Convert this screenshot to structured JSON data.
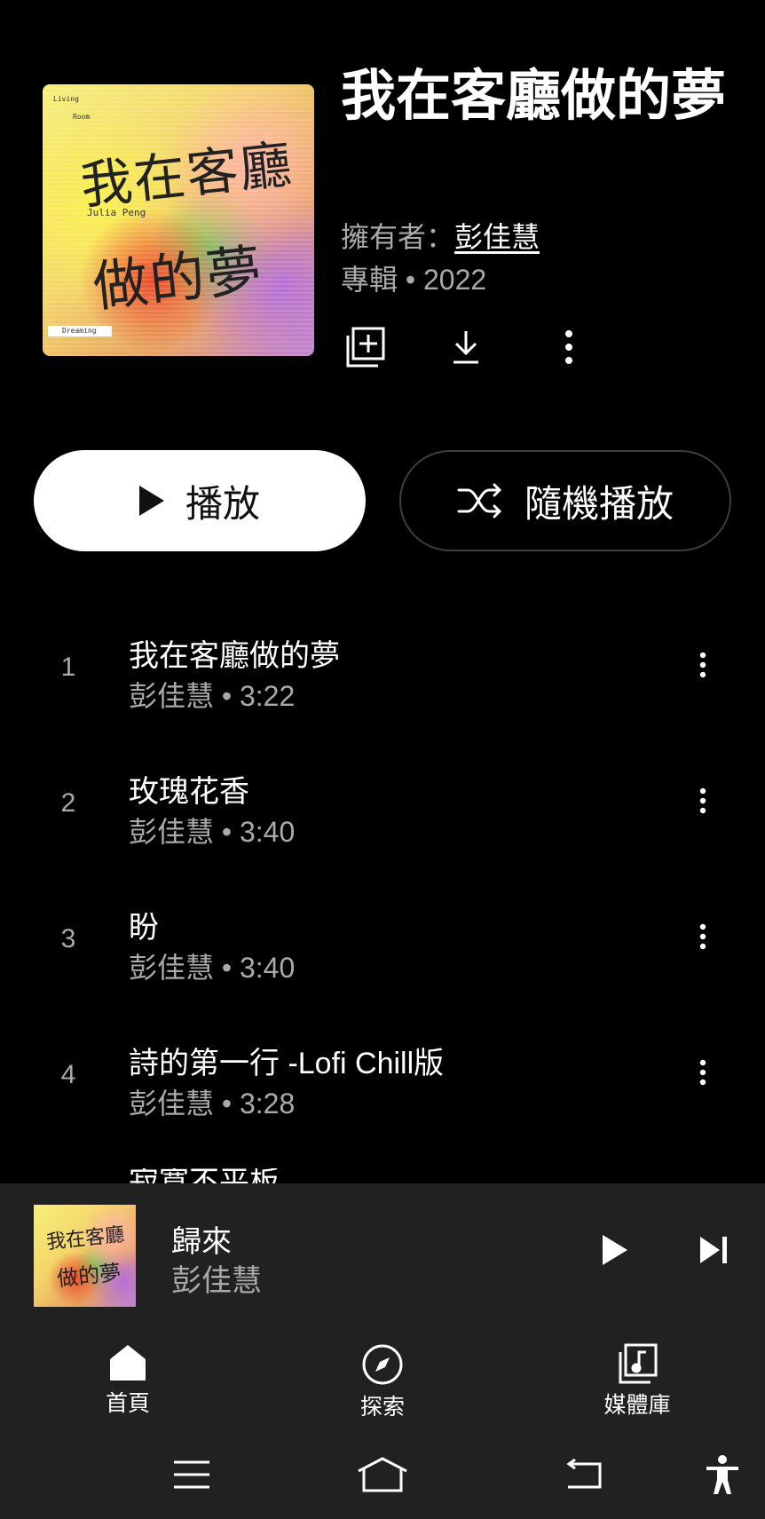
{
  "album": {
    "title": "我在客廳做的夢",
    "owner_label": "擁有者：",
    "owner_name": "彭佳慧",
    "meta": "專輯 • 2022",
    "cover_text": {
      "top_left_1": "Living",
      "top_left_2": "Room",
      "bottom_left": "Dreaming",
      "artist_en": "Julia Peng",
      "line1": "我在客廳",
      "line2": "做的夢"
    }
  },
  "header_actions": {
    "save_icon": "add-to-library-icon",
    "download_icon": "download-icon",
    "more_icon": "more-vert-icon"
  },
  "buttons": {
    "play": "播放",
    "shuffle": "隨機播放"
  },
  "tracks": [
    {
      "num": "1",
      "title": "我在客廳做的夢",
      "sub": "彭佳慧 • 3:22"
    },
    {
      "num": "2",
      "title": "玫瑰花香",
      "sub": "彭佳慧 • 3:40"
    },
    {
      "num": "3",
      "title": "盼",
      "sub": "彭佳慧 • 3:40"
    },
    {
      "num": "4",
      "title": "詩的第一行 -Lofi Chill版",
      "sub": "彭佳慧 • 3:28"
    }
  ],
  "partial_track_title": "寂寞不平板",
  "now_playing": {
    "title": "歸來",
    "artist": "彭佳慧",
    "art_line1": "我在客廳",
    "art_line2": "做的夢"
  },
  "nav": [
    {
      "label": "首頁",
      "icon": "home-icon"
    },
    {
      "label": "探索",
      "icon": "compass-icon"
    },
    {
      "label": "媒體庫",
      "icon": "library-music-icon"
    }
  ],
  "system_bar": {
    "icons": [
      "recent-apps-icon",
      "home-icon",
      "back-icon",
      "accessibility-icon"
    ]
  }
}
